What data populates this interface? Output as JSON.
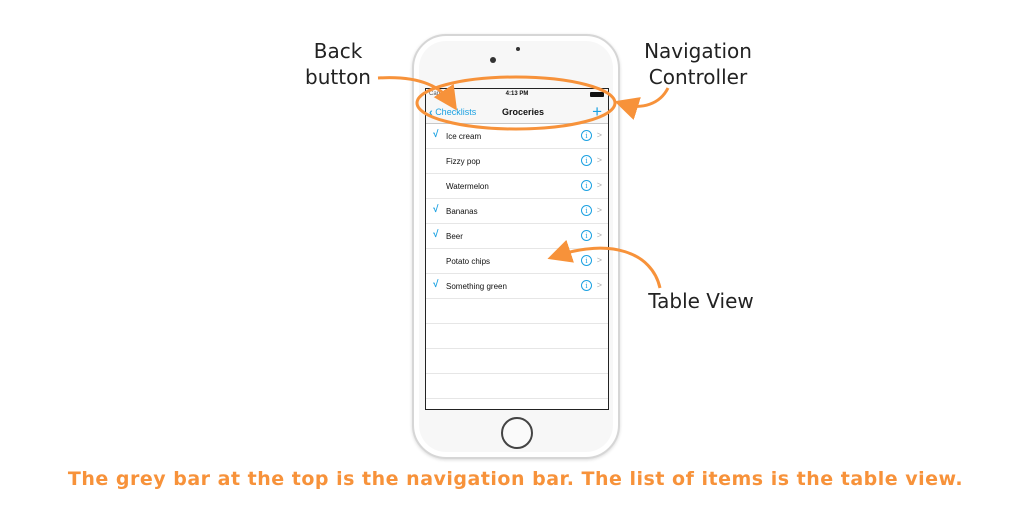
{
  "callouts": {
    "back_button": "Back\nbutton",
    "navigation_controller": "Navigation\nController",
    "table_view": "Table View"
  },
  "status_bar": {
    "carrier": "Carrier",
    "time": "4:13 PM"
  },
  "nav_bar": {
    "back_label": "Checklists",
    "title": "Groceries",
    "add_icon": "plus-icon",
    "back_icon": "chevron-left-icon"
  },
  "table": {
    "items": [
      {
        "text": "Ice cream",
        "checked": true
      },
      {
        "text": "Fizzy pop",
        "checked": false
      },
      {
        "text": "Watermelon",
        "checked": false
      },
      {
        "text": "Bananas",
        "checked": true
      },
      {
        "text": "Beer",
        "checked": true
      },
      {
        "text": "Potato chips",
        "checked": false
      },
      {
        "text": "Something green",
        "checked": true
      }
    ],
    "empty_rows": 5,
    "check_glyph": "√",
    "info_glyph": "i",
    "disclosure_glyph": ">"
  },
  "caption": "The grey bar at the top is the navigation bar. The list of items is the table view.",
  "colors": {
    "accent": "#1ba1e2",
    "annotation": "#f7923a"
  }
}
